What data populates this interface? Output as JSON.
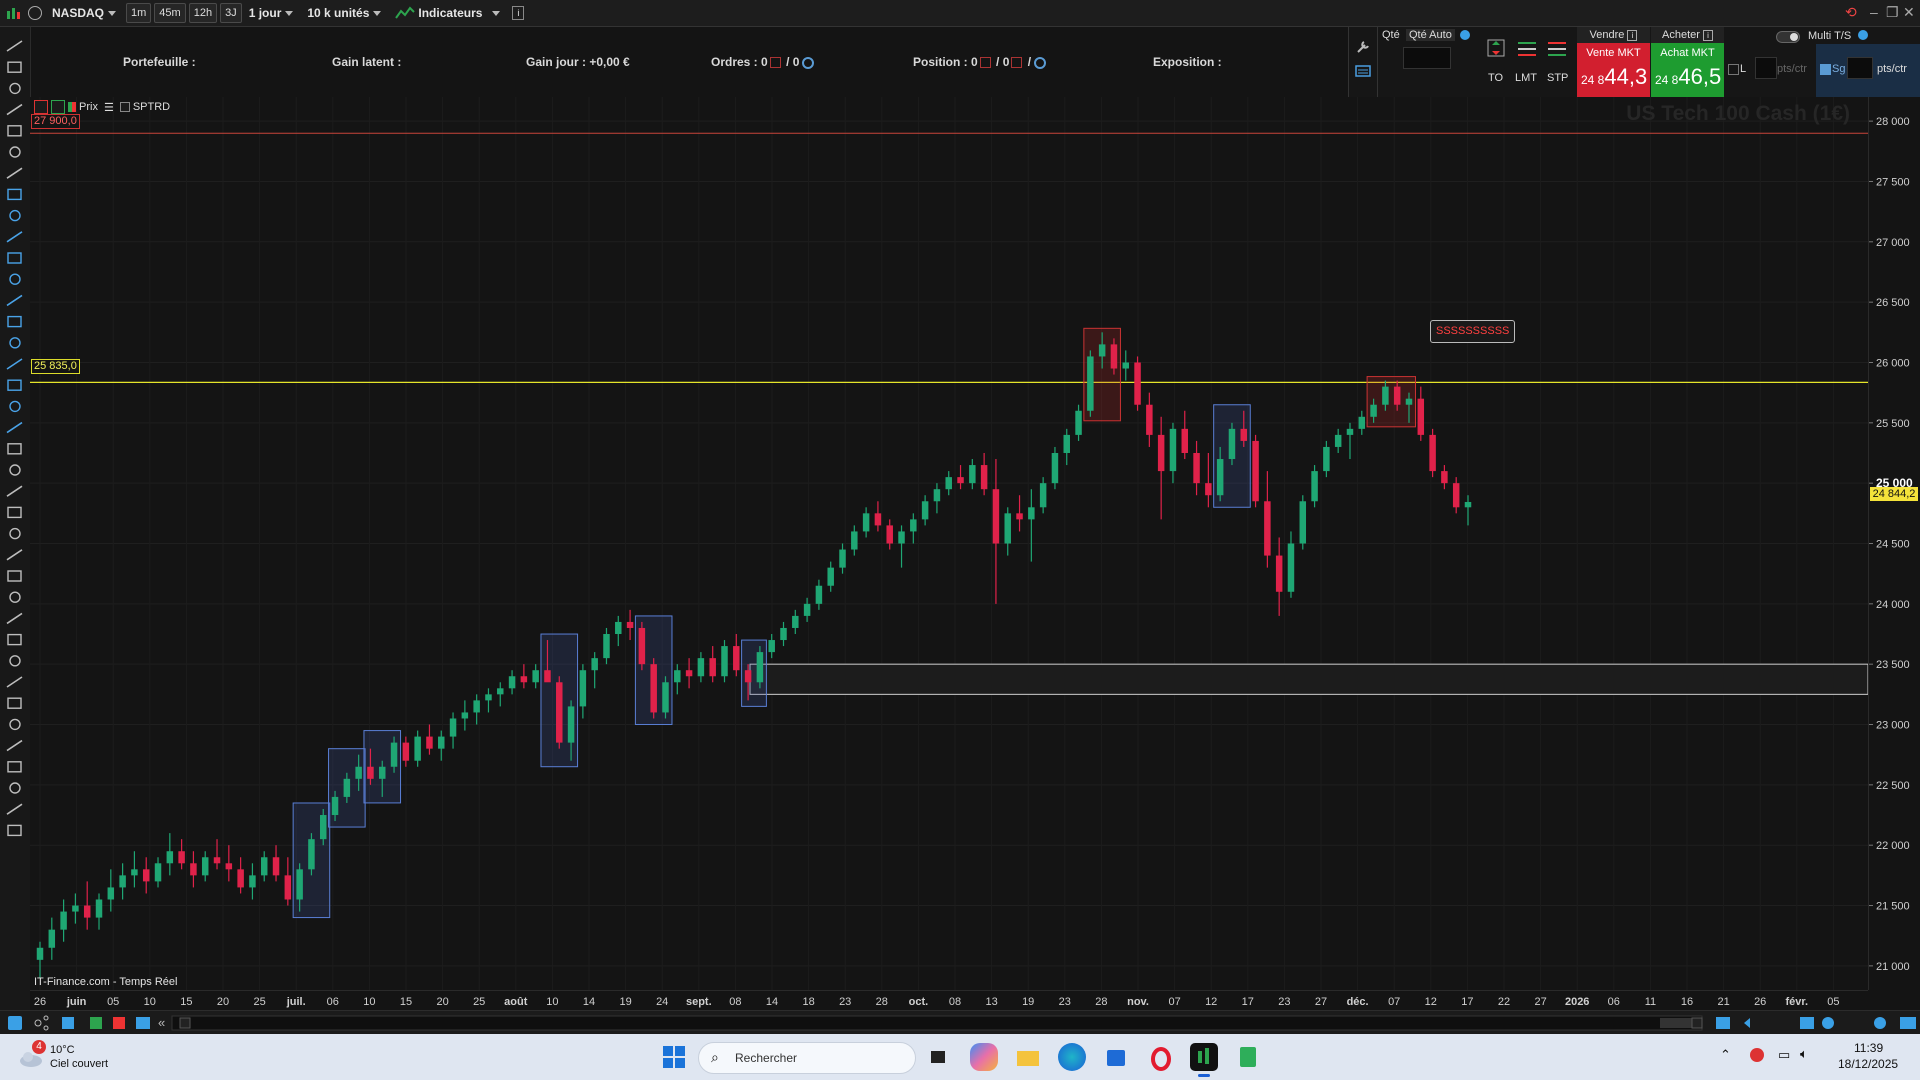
{
  "toolbar": {
    "instrument": "NASDAQ",
    "timeframes": [
      "1m",
      "45m",
      "12h",
      "3J"
    ],
    "period": "1 jour",
    "units": "10 k unités",
    "indicators": "Indicateurs"
  },
  "infobar": {
    "portefeuille": "Portefeuille :",
    "gain_latent": "Gain latent :",
    "gain_jour": "Gain jour : +0,00 €",
    "ordres_label": "Ordres :",
    "ordres_a": "0",
    "ordres_b": "/ 0",
    "position_label": "Position :",
    "position_a": "0",
    "position_b": "/ 0",
    "position_c": "/",
    "exposition": "Exposition :"
  },
  "orderpanel": {
    "qte": "Qté",
    "qte_auto": "Qté Auto",
    "to": "TO",
    "lmt": "LMT",
    "stp": "STP",
    "vendre": "Vendre",
    "acheter": "Acheter",
    "vente_mkt": "Vente MKT",
    "achat_mkt": "Achat MKT",
    "sell_prefix": "24 8",
    "sell_big": "44,3",
    "buy_prefix": "24 8",
    "buy_big": "46,5",
    "multi_ts": "Multi T/S",
    "l_label": "L",
    "sg_label": "Sg",
    "pts_ctr": "pts/ctr",
    "pts_ctr2": "pts/ctr"
  },
  "pane": {
    "prix": "Prix",
    "sptrd": "SPTRD",
    "watermark": "US Tech 100 Cash (1€)",
    "source": "IT-Finance.com - Temps Réel",
    "level_top": "27 900,0",
    "level_mid": "25 835,0",
    "annotation": "SSSSSSSSSS",
    "current_price": "24 844,2"
  },
  "price_axis": [
    "28 000",
    "27 500",
    "27 000",
    "26 500",
    "26 000",
    "25 500",
    "25 000",
    "24 500",
    "24 000",
    "23 500",
    "23 000",
    "22 500",
    "22 000",
    "21 500",
    "21 000"
  ],
  "date_axis": [
    {
      "t": "26",
      "b": false
    },
    {
      "t": "juin",
      "b": true
    },
    {
      "t": "05",
      "b": false
    },
    {
      "t": "10",
      "b": false
    },
    {
      "t": "15",
      "b": false
    },
    {
      "t": "20",
      "b": false
    },
    {
      "t": "25",
      "b": false
    },
    {
      "t": "juil.",
      "b": true
    },
    {
      "t": "06",
      "b": false
    },
    {
      "t": "10",
      "b": false
    },
    {
      "t": "15",
      "b": false
    },
    {
      "t": "20",
      "b": false
    },
    {
      "t": "25",
      "b": false
    },
    {
      "t": "août",
      "b": true
    },
    {
      "t": "10",
      "b": false
    },
    {
      "t": "14",
      "b": false
    },
    {
      "t": "19",
      "b": false
    },
    {
      "t": "24",
      "b": false
    },
    {
      "t": "sept.",
      "b": true
    },
    {
      "t": "08",
      "b": false
    },
    {
      "t": "14",
      "b": false
    },
    {
      "t": "18",
      "b": false
    },
    {
      "t": "23",
      "b": false
    },
    {
      "t": "28",
      "b": false
    },
    {
      "t": "oct.",
      "b": true
    },
    {
      "t": "08",
      "b": false
    },
    {
      "t": "13",
      "b": false
    },
    {
      "t": "19",
      "b": false
    },
    {
      "t": "23",
      "b": false
    },
    {
      "t": "28",
      "b": false
    },
    {
      "t": "nov.",
      "b": true
    },
    {
      "t": "07",
      "b": false
    },
    {
      "t": "12",
      "b": false
    },
    {
      "t": "17",
      "b": false
    },
    {
      "t": "23",
      "b": false
    },
    {
      "t": "27",
      "b": false
    },
    {
      "t": "déc.",
      "b": true
    },
    {
      "t": "07",
      "b": false
    },
    {
      "t": "12",
      "b": false
    },
    {
      "t": "17",
      "b": false
    },
    {
      "t": "22",
      "b": false
    },
    {
      "t": "27",
      "b": false
    },
    {
      "t": "2026",
      "b": true
    },
    {
      "t": "06",
      "b": false
    },
    {
      "t": "11",
      "b": false
    },
    {
      "t": "16",
      "b": false
    },
    {
      "t": "21",
      "b": false
    },
    {
      "t": "26",
      "b": false
    },
    {
      "t": "févr.",
      "b": true
    },
    {
      "t": "05",
      "b": false
    }
  ],
  "taskbar": {
    "temp": "10°C",
    "weather": "Ciel couvert",
    "badge": "4",
    "search": "Rechercher",
    "time": "11:39",
    "date": "18/12/2025"
  },
  "colors": {
    "up": "#1fa774",
    "down": "#e0224a",
    "bg": "#141414",
    "level": "#e5e52a",
    "sell": "#d21f2f",
    "buy": "#1e9c30"
  },
  "chart_data": {
    "type": "candlestick",
    "y_range": [
      20800,
      28200
    ],
    "candles_ohlc": [
      [
        21050,
        21200,
        20900,
        21150
      ],
      [
        21150,
        21400,
        21050,
        21300
      ],
      [
        21300,
        21550,
        21200,
        21450
      ],
      [
        21450,
        21600,
        21350,
        21500
      ],
      [
        21500,
        21700,
        21300,
        21400
      ],
      [
        21400,
        21600,
        21300,
        21550
      ],
      [
        21550,
        21800,
        21450,
        21650
      ],
      [
        21650,
        21850,
        21550,
        21750
      ],
      [
        21750,
        21950,
        21650,
        21800
      ],
      [
        21800,
        21900,
        21600,
        21700
      ],
      [
        21700,
        21900,
        21650,
        21850
      ],
      [
        21850,
        22100,
        21750,
        21950
      ],
      [
        21950,
        22050,
        21800,
        21850
      ],
      [
        21850,
        21950,
        21650,
        21750
      ],
      [
        21750,
        21950,
        21700,
        21900
      ],
      [
        21900,
        22050,
        21800,
        21850
      ],
      [
        21850,
        22000,
        21700,
        21800
      ],
      [
        21800,
        21900,
        21600,
        21650
      ],
      [
        21650,
        21850,
        21550,
        21750
      ],
      [
        21750,
        21950,
        21700,
        21900
      ],
      [
        21900,
        22000,
        21700,
        21750
      ],
      [
        21750,
        21900,
        21500,
        21550
      ],
      [
        21550,
        21850,
        21450,
        21800
      ],
      [
        21800,
        22100,
        21750,
        22050
      ],
      [
        22050,
        22300,
        22000,
        22250
      ],
      [
        22250,
        22450,
        22200,
        22400
      ],
      [
        22400,
        22600,
        22350,
        22550
      ],
      [
        22550,
        22750,
        22450,
        22650
      ],
      [
        22650,
        22800,
        22500,
        22550
      ],
      [
        22550,
        22700,
        22400,
        22650
      ],
      [
        22650,
        22900,
        22600,
        22850
      ],
      [
        22850,
        22900,
        22650,
        22700
      ],
      [
        22700,
        22950,
        22650,
        22900
      ],
      [
        22900,
        23000,
        22750,
        22800
      ],
      [
        22800,
        22950,
        22700,
        22900
      ],
      [
        22900,
        23100,
        22800,
        23050
      ],
      [
        23050,
        23200,
        22950,
        23100
      ],
      [
        23100,
        23250,
        23000,
        23200
      ],
      [
        23200,
        23300,
        23100,
        23250
      ],
      [
        23250,
        23350,
        23150,
        23300
      ],
      [
        23300,
        23450,
        23250,
        23400
      ],
      [
        23400,
        23500,
        23300,
        23350
      ],
      [
        23350,
        23500,
        23300,
        23450
      ],
      [
        23450,
        23700,
        23400,
        23350
      ],
      [
        23350,
        23400,
        22800,
        22850
      ],
      [
        22850,
        23200,
        22700,
        23150
      ],
      [
        23150,
        23500,
        23050,
        23450
      ],
      [
        23450,
        23600,
        23300,
        23550
      ],
      [
        23550,
        23800,
        23500,
        23750
      ],
      [
        23750,
        23900,
        23650,
        23850
      ],
      [
        23850,
        23950,
        23700,
        23800
      ],
      [
        23800,
        23850,
        23450,
        23500
      ],
      [
        23500,
        23550,
        23050,
        23100
      ],
      [
        23100,
        23400,
        23050,
        23350
      ],
      [
        23350,
        23500,
        23250,
        23450
      ],
      [
        23450,
        23550,
        23300,
        23400
      ],
      [
        23400,
        23600,
        23350,
        23550
      ],
      [
        23550,
        23650,
        23350,
        23400
      ],
      [
        23400,
        23700,
        23350,
        23650
      ],
      [
        23650,
        23750,
        23400,
        23450
      ],
      [
        23450,
        23500,
        23200,
        23350
      ],
      [
        23350,
        23650,
        23300,
        23600
      ],
      [
        23600,
        23750,
        23550,
        23700
      ],
      [
        23700,
        23850,
        23650,
        23800
      ],
      [
        23800,
        23950,
        23750,
        23900
      ],
      [
        23900,
        24050,
        23850,
        24000
      ],
      [
        24000,
        24200,
        23950,
        24150
      ],
      [
        24150,
        24350,
        24100,
        24300
      ],
      [
        24300,
        24500,
        24250,
        24450
      ],
      [
        24450,
        24650,
        24400,
        24600
      ],
      [
        24600,
        24800,
        24550,
        24750
      ],
      [
        24750,
        24850,
        24600,
        24650
      ],
      [
        24650,
        24700,
        24450,
        24500
      ],
      [
        24500,
        24650,
        24300,
        24600
      ],
      [
        24600,
        24750,
        24500,
        24700
      ],
      [
        24700,
        24900,
        24650,
        24850
      ],
      [
        24850,
        25000,
        24750,
        24950
      ],
      [
        24950,
        25100,
        24900,
        25050
      ],
      [
        25050,
        25150,
        24950,
        25000
      ],
      [
        25000,
        25200,
        24950,
        25150
      ],
      [
        25150,
        25250,
        24900,
        24950
      ],
      [
        24950,
        25200,
        24000,
        24500
      ],
      [
        24500,
        24800,
        24400,
        24750
      ],
      [
        24750,
        24900,
        24600,
        24700
      ],
      [
        24700,
        24950,
        24350,
        24800
      ],
      [
        24800,
        25050,
        24750,
        25000
      ],
      [
        25000,
        25300,
        24950,
        25250
      ],
      [
        25250,
        25450,
        25150,
        25400
      ],
      [
        25400,
        25650,
        25350,
        25600
      ],
      [
        25600,
        26100,
        25550,
        26050
      ],
      [
        26050,
        26250,
        25950,
        26150
      ],
      [
        26150,
        26200,
        25900,
        25950
      ],
      [
        25950,
        26100,
        25850,
        26000
      ],
      [
        26000,
        26050,
        25600,
        25650
      ],
      [
        25650,
        25750,
        25300,
        25400
      ],
      [
        25400,
        25550,
        24700,
        25100
      ],
      [
        25100,
        25500,
        25000,
        25450
      ],
      [
        25450,
        25600,
        25200,
        25250
      ],
      [
        25250,
        25350,
        24900,
        25000
      ],
      [
        25000,
        25250,
        24800,
        24900
      ],
      [
        24900,
        25300,
        24850,
        25200
      ],
      [
        25200,
        25500,
        25150,
        25450
      ],
      [
        25450,
        25600,
        25300,
        25350
      ],
      [
        25350,
        25400,
        24800,
        24850
      ],
      [
        24850,
        25100,
        24300,
        24400
      ],
      [
        24400,
        24550,
        23900,
        24100
      ],
      [
        24100,
        24600,
        24050,
        24500
      ],
      [
        24500,
        24900,
        24450,
        24850
      ],
      [
        24850,
        25150,
        24800,
        25100
      ],
      [
        25100,
        25350,
        25050,
        25300
      ],
      [
        25300,
        25450,
        25250,
        25400
      ],
      [
        25400,
        25500,
        25200,
        25450
      ],
      [
        25450,
        25600,
        25400,
        25550
      ],
      [
        25550,
        25700,
        25500,
        25650
      ],
      [
        25650,
        25850,
        25600,
        25800
      ],
      [
        25800,
        25850,
        25600,
        25650
      ],
      [
        25650,
        25750,
        25500,
        25700
      ],
      [
        25700,
        25800,
        25350,
        25400
      ],
      [
        25400,
        25450,
        25050,
        25100
      ],
      [
        25100,
        25150,
        24950,
        25000
      ],
      [
        25000,
        25050,
        24750,
        24800
      ],
      [
        24800,
        24900,
        24650,
        24844
      ]
    ],
    "boxes_blue": [
      "juil. block 1",
      "juil. block 2",
      "juil. block 3",
      "août block 1",
      "août block 2",
      "sept. block",
      "nov. block"
    ],
    "boxes_red": [
      "late oct. top",
      "early déc. top"
    ],
    "levels": [
      27900,
      25835,
      23500,
      23250
    ]
  }
}
